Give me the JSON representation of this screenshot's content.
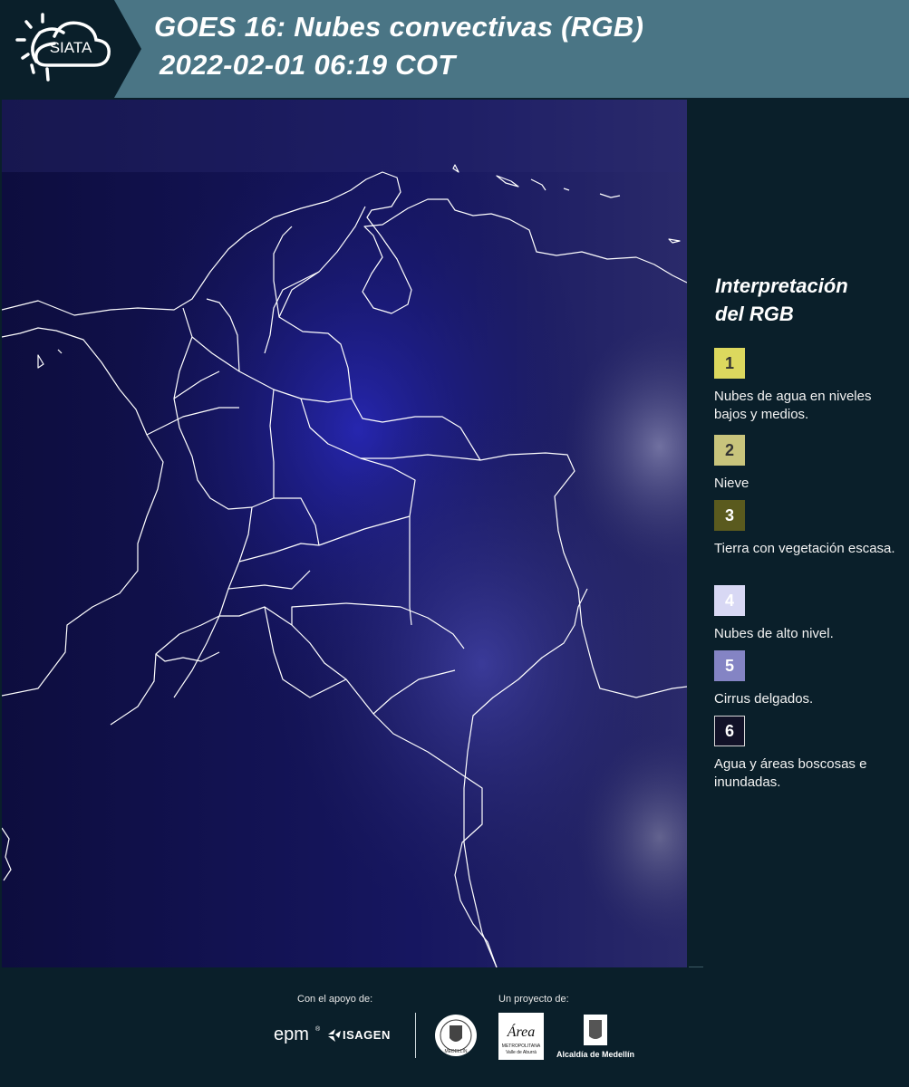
{
  "header": {
    "logo_text": "SIATA",
    "title_line1": "GOES 16: Nubes convectivas (RGB)",
    "title_line2": "2022-02-01 06:19 COT"
  },
  "map": {
    "base_color": "#10104a",
    "border_color": "#ffffff"
  },
  "legend": {
    "title_line1": "Interpretación",
    "title_line2": "del RGB",
    "items": [
      {
        "number": "1",
        "label": "Nubes de agua en niveles bajos y medios.",
        "color": "#dcd85e"
      },
      {
        "number": "2",
        "label": "Nieve",
        "color": "#c8c47c"
      },
      {
        "number": "3",
        "label": "Tierra con vegetación escasa.",
        "color": "#5a5a1e"
      },
      {
        "number": "4",
        "label": "Nubes de alto nivel.",
        "color": "#d8d8f4"
      },
      {
        "number": "5",
        "label": "Cirrus delgados.",
        "color": "#8484c4"
      },
      {
        "number": "6",
        "label": "Agua y áreas boscosas e inundadas.",
        "color": "#121228"
      }
    ]
  },
  "footer": {
    "support_label": "Con el apoyo de:",
    "project_label": "Un proyecto de:",
    "epm_logo": "epm",
    "isagen_logo": "ISAGEN",
    "area_logo": "Área",
    "area_sub1": "METROPOLITANA",
    "area_sub2": "Valle de Aburrá",
    "alcaldia_logo": "Alcaldía de Medellín",
    "medellin_seal": "MEDELLÍN"
  }
}
